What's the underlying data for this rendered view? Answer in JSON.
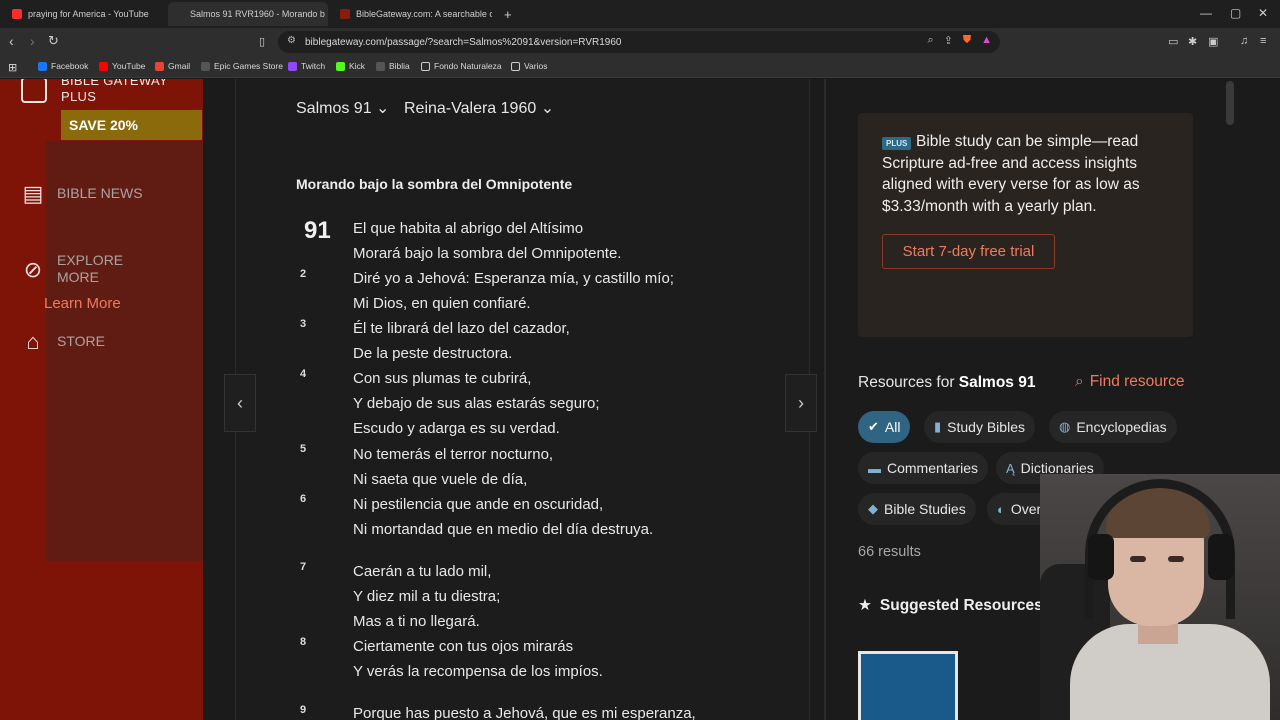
{
  "browser": {
    "tabs": [
      {
        "label": "praying for America - YouTube",
        "color": "#ff2a2a"
      },
      {
        "label": "Salmos 91 RVR1960 - Morando b",
        "color": "#8a1c0c"
      },
      {
        "label": "BibleGateway.com: A searchable onli",
        "color": "#8a1c0c"
      }
    ],
    "new_tab": "+",
    "url": "biblegateway.com/passage/?search=Salmos%2091&version=RVR1960",
    "bookmarks": [
      {
        "label": "Facebook",
        "color": "#1877f2"
      },
      {
        "label": "YouTube",
        "color": "#ff0000"
      },
      {
        "label": "Gmail",
        "color": "#ea4335"
      },
      {
        "label": "Epic Games Store",
        "color": "#333333"
      },
      {
        "label": "Twitch",
        "color": "#9146ff"
      },
      {
        "label": "Kick",
        "color": "#53fc18"
      },
      {
        "label": "Biblia",
        "color": "#2e2e2e"
      },
      {
        "label": "Fondo Naturaleza",
        "color": "#2e2e2e"
      },
      {
        "label": "Varios",
        "color": "#2e2e2e"
      }
    ]
  },
  "sidebar": {
    "logo_line1": "BIBLE GATEWAY",
    "logo_line2": "PLUS",
    "save": "SAVE 20%",
    "items": [
      {
        "label": "BIBLE NEWS"
      },
      {
        "label_line1": "EXPLORE",
        "label_line2": "MORE"
      },
      {
        "label": "STORE"
      }
    ]
  },
  "passage": {
    "book_selector": "Salmos 91",
    "version_selector": "Reina-Valera 1960",
    "heading": "Morando bajo la sombra del Omnipotente",
    "chapter": "91",
    "verse_numbers": [
      "2",
      "3",
      "4",
      "5",
      "6",
      "7",
      "8",
      "9"
    ],
    "lines": [
      "El que habita al abrigo del Altísimo",
      "Morará bajo la sombra del Omnipotente.",
      "Diré yo a Jehová: Esperanza mía, y castillo mío;",
      "Mi Dios, en quien confiaré.",
      "Él te librará del lazo del cazador,",
      "De la peste destructora.",
      "Con sus plumas te cubrirá,",
      "Y debajo de sus alas estarás seguro;",
      "Escudo y adarga es su verdad.",
      "No temerás el terror nocturno,",
      "Ni saeta que vuele de día,",
      "Ni pestilencia que ande en oscuridad,",
      "Ni mortandad que en medio del día destruya.",
      "Caerán a tu lado mil,",
      "Y diez mil a tu diestra;",
      "Mas a ti no llegará.",
      "Ciertamente con tus ojos mirarás",
      "Y verás la recompensa de los impíos.",
      "Porque has puesto a Jehová, que es mi esperanza,"
    ]
  },
  "promo": {
    "badge": "PLUS",
    "text": "Bible study can be simple—read Scripture ad-free and access insights aligned with every verse for as low as $3.33/month with a yearly plan.",
    "trial_button": "Start 7-day free trial",
    "learn_more": "Learn More"
  },
  "resources": {
    "title_prefix": "Resources for ",
    "title_bold": "Salmos 91",
    "find": "Find resource",
    "chips": [
      {
        "label": "All",
        "icon": "check-icon",
        "active": true
      },
      {
        "label": "Study Bibles",
        "icon": "book-plus-icon"
      },
      {
        "label": "Encyclopedias",
        "icon": "globe-icon"
      },
      {
        "label": "Commentaries",
        "icon": "comment-icon"
      },
      {
        "label": "Dictionaries",
        "icon": "dictionary-icon"
      },
      {
        "label": "Bible Studies",
        "icon": "study-icon"
      },
      {
        "label": "Overview",
        "icon": "compass-icon"
      }
    ],
    "results": "66 results",
    "suggested": "Suggested Resources"
  }
}
